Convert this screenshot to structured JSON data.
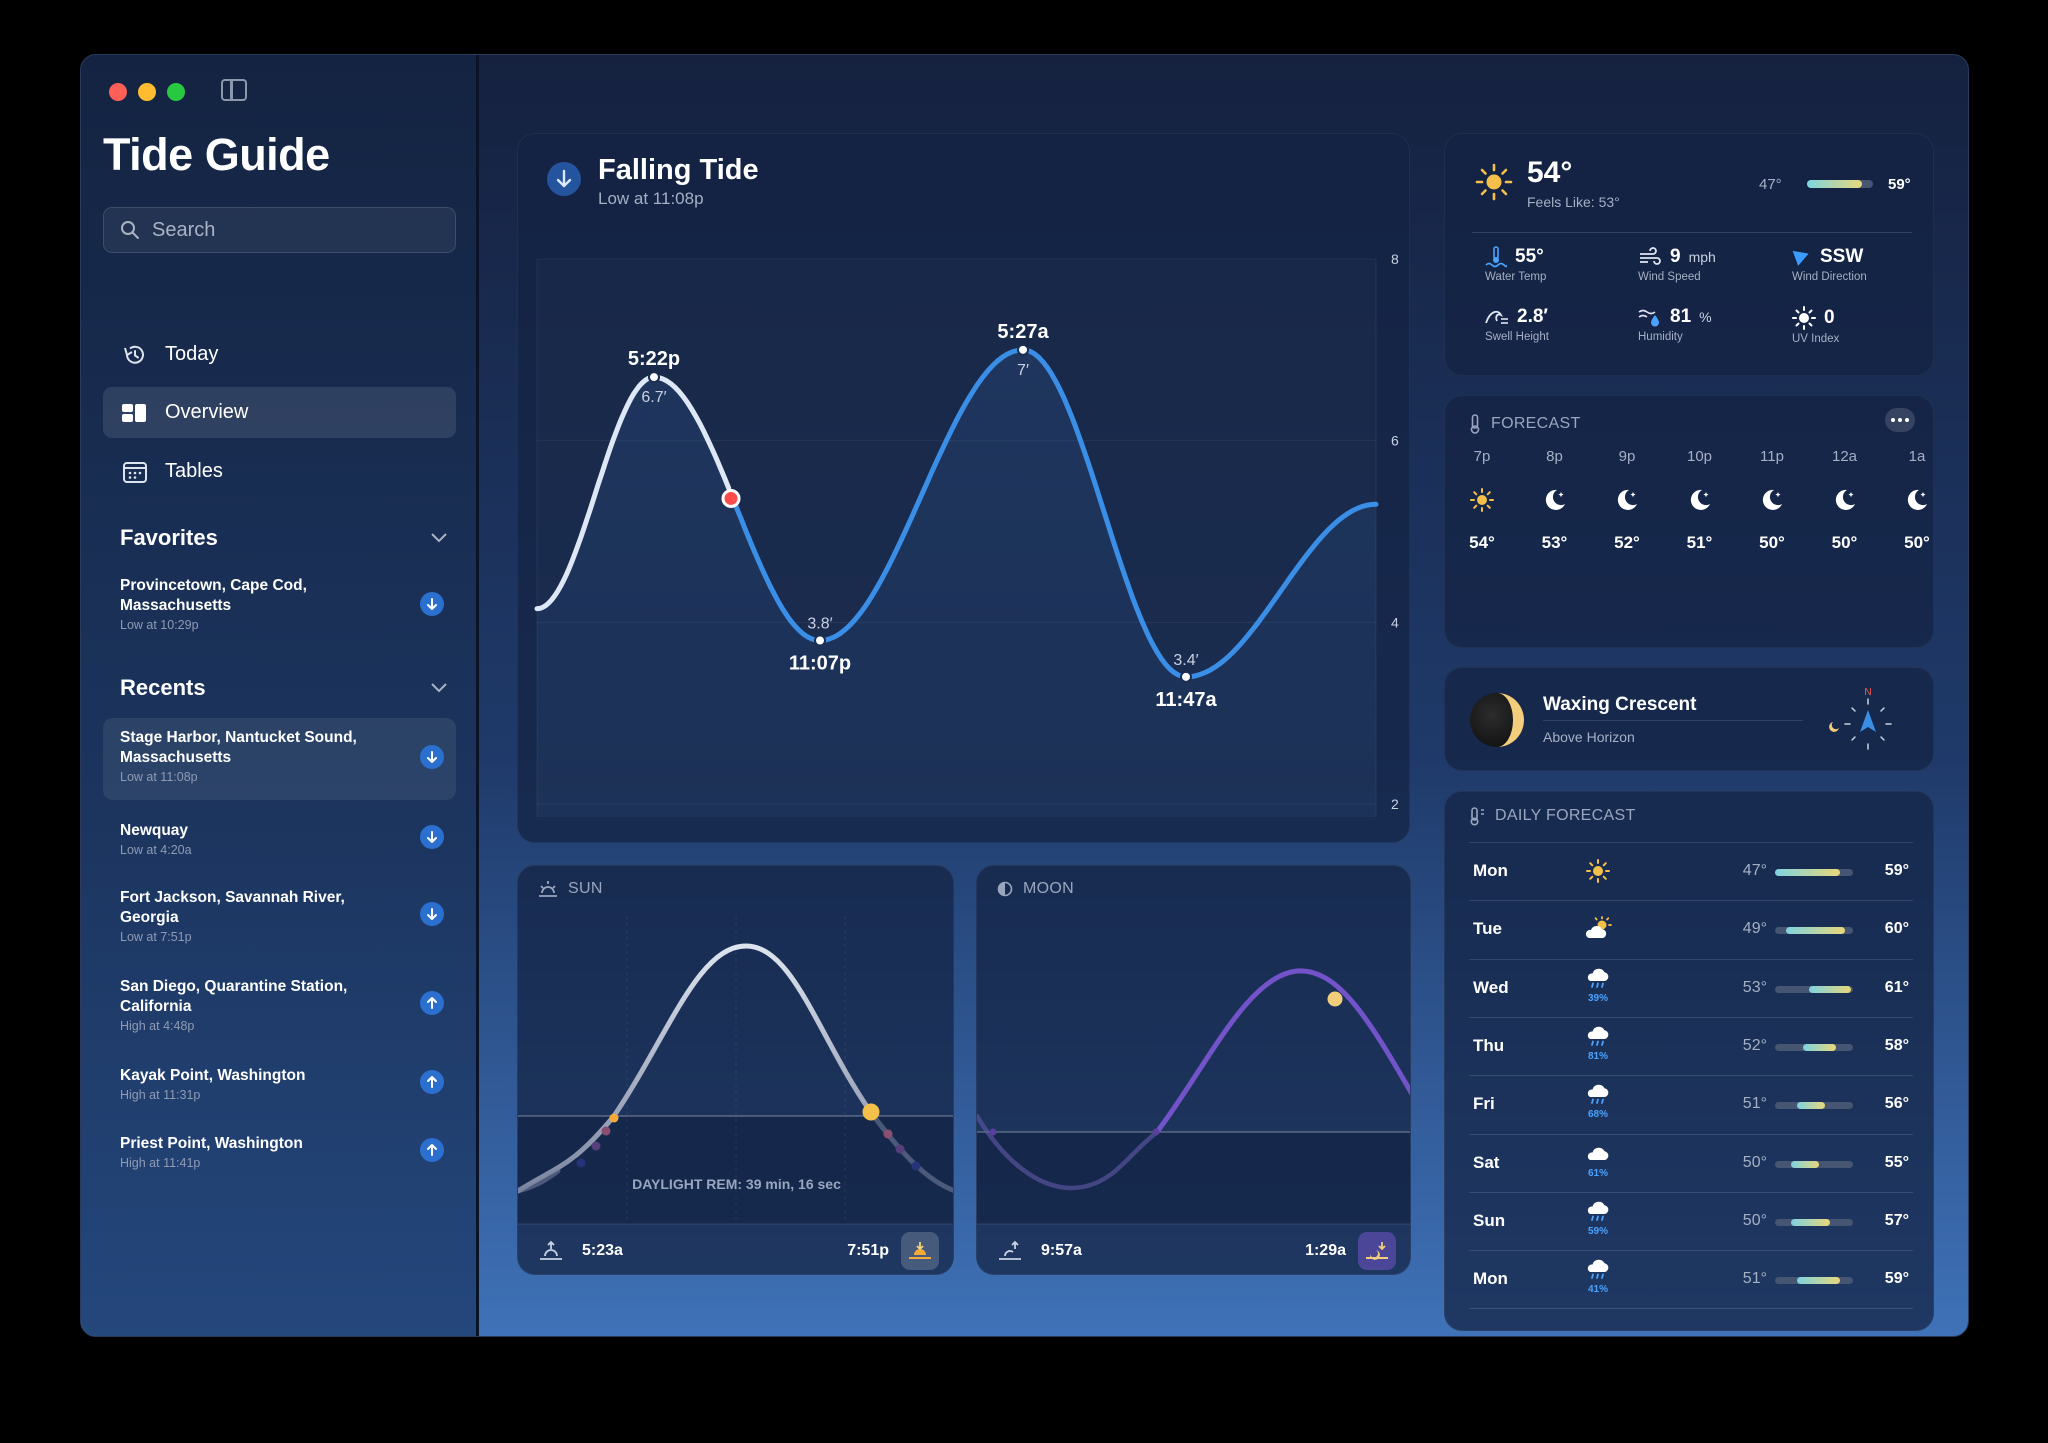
{
  "app": {
    "title": "Tide Guide"
  },
  "search": {
    "placeholder": "Search"
  },
  "nav": [
    {
      "label": "Today",
      "icon": "clock-history-icon"
    },
    {
      "label": "Overview",
      "icon": "overview-grid-icon"
    },
    {
      "label": "Tables",
      "icon": "calendar-table-icon"
    }
  ],
  "favorites": {
    "title": "Favorites",
    "items": [
      {
        "name": "Provincetown, Cape Cod, Massachusetts",
        "sub": "Low at 10:29p",
        "direction": "down"
      }
    ]
  },
  "recents": {
    "title": "Recents",
    "items": [
      {
        "name": "Stage Harbor, Nantucket Sound, Massachusetts",
        "sub": "Low at 11:08p",
        "direction": "down"
      },
      {
        "name": "Newquay",
        "sub": "Low at 4:20a",
        "direction": "down"
      },
      {
        "name": "Fort Jackson, Savannah River, Georgia",
        "sub": "Low at 7:51p",
        "direction": "down"
      },
      {
        "name": "San Diego, Quarantine Station, California",
        "sub": "High at 4:48p",
        "direction": "up"
      },
      {
        "name": "Kayak Point, Washington",
        "sub": "High at 11:31p",
        "direction": "up"
      },
      {
        "name": "Priest Point, Washington",
        "sub": "High at 11:41p",
        "direction": "up"
      }
    ]
  },
  "tide": {
    "title": "Falling Tide",
    "subtitle": "Low at 11:08p",
    "y_ticks": [
      "8",
      "6",
      "4",
      "2"
    ],
    "extremes": [
      {
        "time": "5:22p",
        "height": "6.7′"
      },
      {
        "time": "11:07p",
        "height": "3.8′"
      },
      {
        "time": "5:27a",
        "height": "7′"
      },
      {
        "time": "11:47a",
        "height": "3.4′"
      }
    ]
  },
  "chart_data": {
    "type": "line",
    "title": "Falling Tide",
    "ylim": [
      2,
      8
    ],
    "y_ticks": [
      8,
      6,
      4,
      2
    ],
    "grid": true,
    "series": [
      {
        "points": [
          {
            "label": "5:22p",
            "y": 6.7
          },
          {
            "label": "11:07p",
            "y": 3.8
          },
          {
            "label": "5:27a",
            "y": 7.0
          },
          {
            "label": "11:47a",
            "y": 3.4
          }
        ]
      }
    ],
    "current_height": 5.6
  },
  "weather": {
    "temp": "54°",
    "feels_like": "Feels Like: 53°",
    "low": "47°",
    "high": "59°",
    "range_fraction": [
      0.0,
      0.83
    ],
    "metrics": [
      {
        "value": "55°",
        "unit": "",
        "label": "Water Temp",
        "icon": "water-thermometer-icon"
      },
      {
        "value": "9",
        "unit": "mph",
        "label": "Wind Speed",
        "icon": "wind-icon"
      },
      {
        "value": "SSW",
        "unit": "",
        "label": "Wind Direction",
        "icon": "location-arrow-icon"
      },
      {
        "value": "2.8′",
        "unit": "",
        "label": "Swell Height",
        "icon": "wave-icon"
      },
      {
        "value": "81",
        "unit": "%",
        "label": "Humidity",
        "icon": "humidity-icon"
      },
      {
        "value": "0",
        "unit": "",
        "label": "UV Index",
        "icon": "uv-sun-icon"
      }
    ]
  },
  "forecast": {
    "title": "FORECAST",
    "hours": [
      {
        "time": "7p",
        "temp": "54°",
        "icon": "sun"
      },
      {
        "time": "8p",
        "temp": "53°",
        "icon": "moon"
      },
      {
        "time": "9p",
        "temp": "52°",
        "icon": "moon"
      },
      {
        "time": "10p",
        "temp": "51°",
        "icon": "moon"
      },
      {
        "time": "11p",
        "temp": "50°",
        "icon": "moon"
      },
      {
        "time": "12a",
        "temp": "50°",
        "icon": "moon"
      },
      {
        "time": "1a",
        "temp": "50°",
        "icon": "moon"
      }
    ]
  },
  "moon_phase": {
    "name": "Waxing Crescent",
    "position": "Above Horizon",
    "compass": "N"
  },
  "daily": {
    "title": "DAILY FORECAST",
    "days": [
      {
        "day": "Mon",
        "icon": "sun",
        "precip": "",
        "low": "47°",
        "high": "59°",
        "bar": [
          0.0,
          0.83
        ]
      },
      {
        "day": "Tue",
        "icon": "partly-sunny",
        "precip": "",
        "low": "49°",
        "high": "60°",
        "bar": [
          0.14,
          0.9
        ]
      },
      {
        "day": "Wed",
        "icon": "rain",
        "precip": "39%",
        "low": "53°",
        "high": "61°",
        "bar": [
          0.43,
          0.97
        ]
      },
      {
        "day": "Thu",
        "icon": "rain",
        "precip": "81%",
        "low": "52°",
        "high": "58°",
        "bar": [
          0.36,
          0.78
        ]
      },
      {
        "day": "Fri",
        "icon": "rain",
        "precip": "68%",
        "low": "51°",
        "high": "56°",
        "bar": [
          0.28,
          0.64
        ]
      },
      {
        "day": "Sat",
        "icon": "cloud",
        "precip": "61%",
        "low": "50°",
        "high": "55°",
        "bar": [
          0.21,
          0.57
        ]
      },
      {
        "day": "Sun",
        "icon": "rain",
        "precip": "59%",
        "low": "50°",
        "high": "57°",
        "bar": [
          0.21,
          0.71
        ]
      },
      {
        "day": "Mon",
        "icon": "rain",
        "precip": "41%",
        "low": "51°",
        "high": "59°",
        "bar": [
          0.28,
          0.83
        ]
      }
    ]
  },
  "sun": {
    "title": "SUN",
    "rise": "5:23a",
    "set": "7:51p",
    "daylight": "DAYLIGHT REM: 39 min, 16 sec"
  },
  "moon": {
    "title": "MOON",
    "rise": "9:57a",
    "set": "1:29a"
  },
  "colors": {
    "accent": "#3a8ee6",
    "bar_low": "#7ed3e0",
    "bar_high": "#e8d77a",
    "marker": "#ff4b4b",
    "sun": "#f5c04a"
  }
}
